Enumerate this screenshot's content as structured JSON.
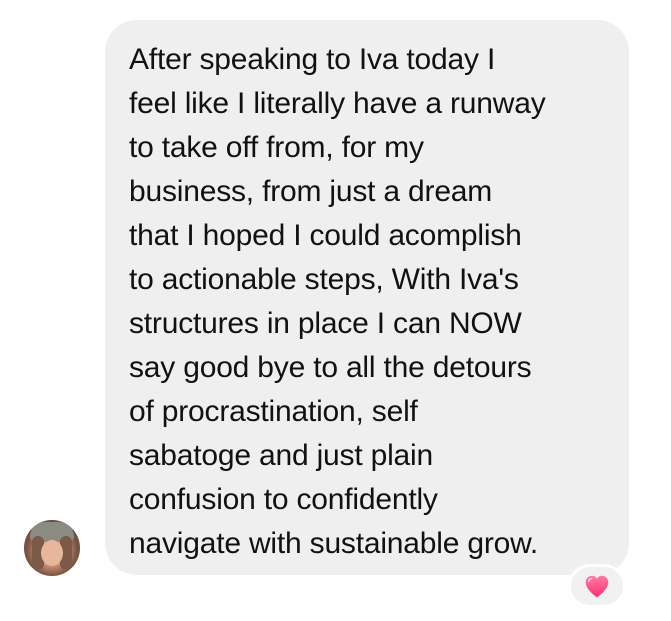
{
  "message": {
    "text": "After speaking to Iva today I\nfeel like I literally have a runway\nto take off from,  for my\nbusiness, from just a dream\nthat I hoped I could acomplish\nto actionable steps, With Iva's\nstructures in place I can NOW\nsay good bye to all the detours\nof procrastination, self\nsabatoge and just plain\nconfusion to confidently\nnavigate with sustainable grow.",
    "bubble_color": "#efefef",
    "text_color": "#111111"
  },
  "sender": {
    "avatar_icon": "profile-photo"
  },
  "reaction": {
    "icon": "heart-icon",
    "color": "#ff3d77"
  }
}
